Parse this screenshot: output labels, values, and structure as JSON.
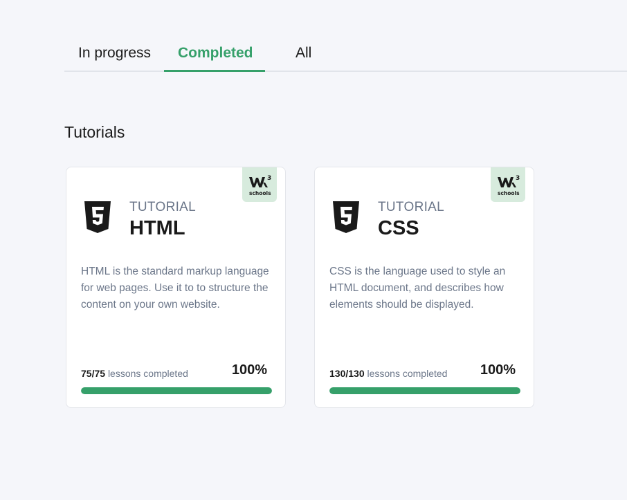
{
  "tabs": [
    {
      "label": "In progress"
    },
    {
      "label": "Completed",
      "active": true
    },
    {
      "label": "All"
    }
  ],
  "section_title": "Tutorials",
  "cards": [
    {
      "kicker": "TUTORIAL",
      "title": "HTML",
      "icon": "html5-icon",
      "description": "HTML is the standard markup language for web pages. Use it to to structure the content on your own website.",
      "lessons_done": "75",
      "lessons_total": "75",
      "lessons_suffix": "lessons completed",
      "percent_label": "100%",
      "progress": 1.0
    },
    {
      "kicker": "TUTORIAL",
      "title": "CSS",
      "icon": "css3-icon",
      "description": "CSS is the language used to style an HTML document, and describes how elements should be displayed.",
      "lessons_done": "130",
      "lessons_total": "130",
      "lessons_suffix": "lessons completed",
      "percent_label": "100%",
      "progress": 1.0
    }
  ],
  "badge": {
    "icon": "w3schools-logo",
    "logo_text": "schools",
    "logo_sup": "3"
  },
  "colors": {
    "accent": "#36a06a",
    "badge_bg": "#d7ebdd",
    "muted": "#6b7689"
  }
}
